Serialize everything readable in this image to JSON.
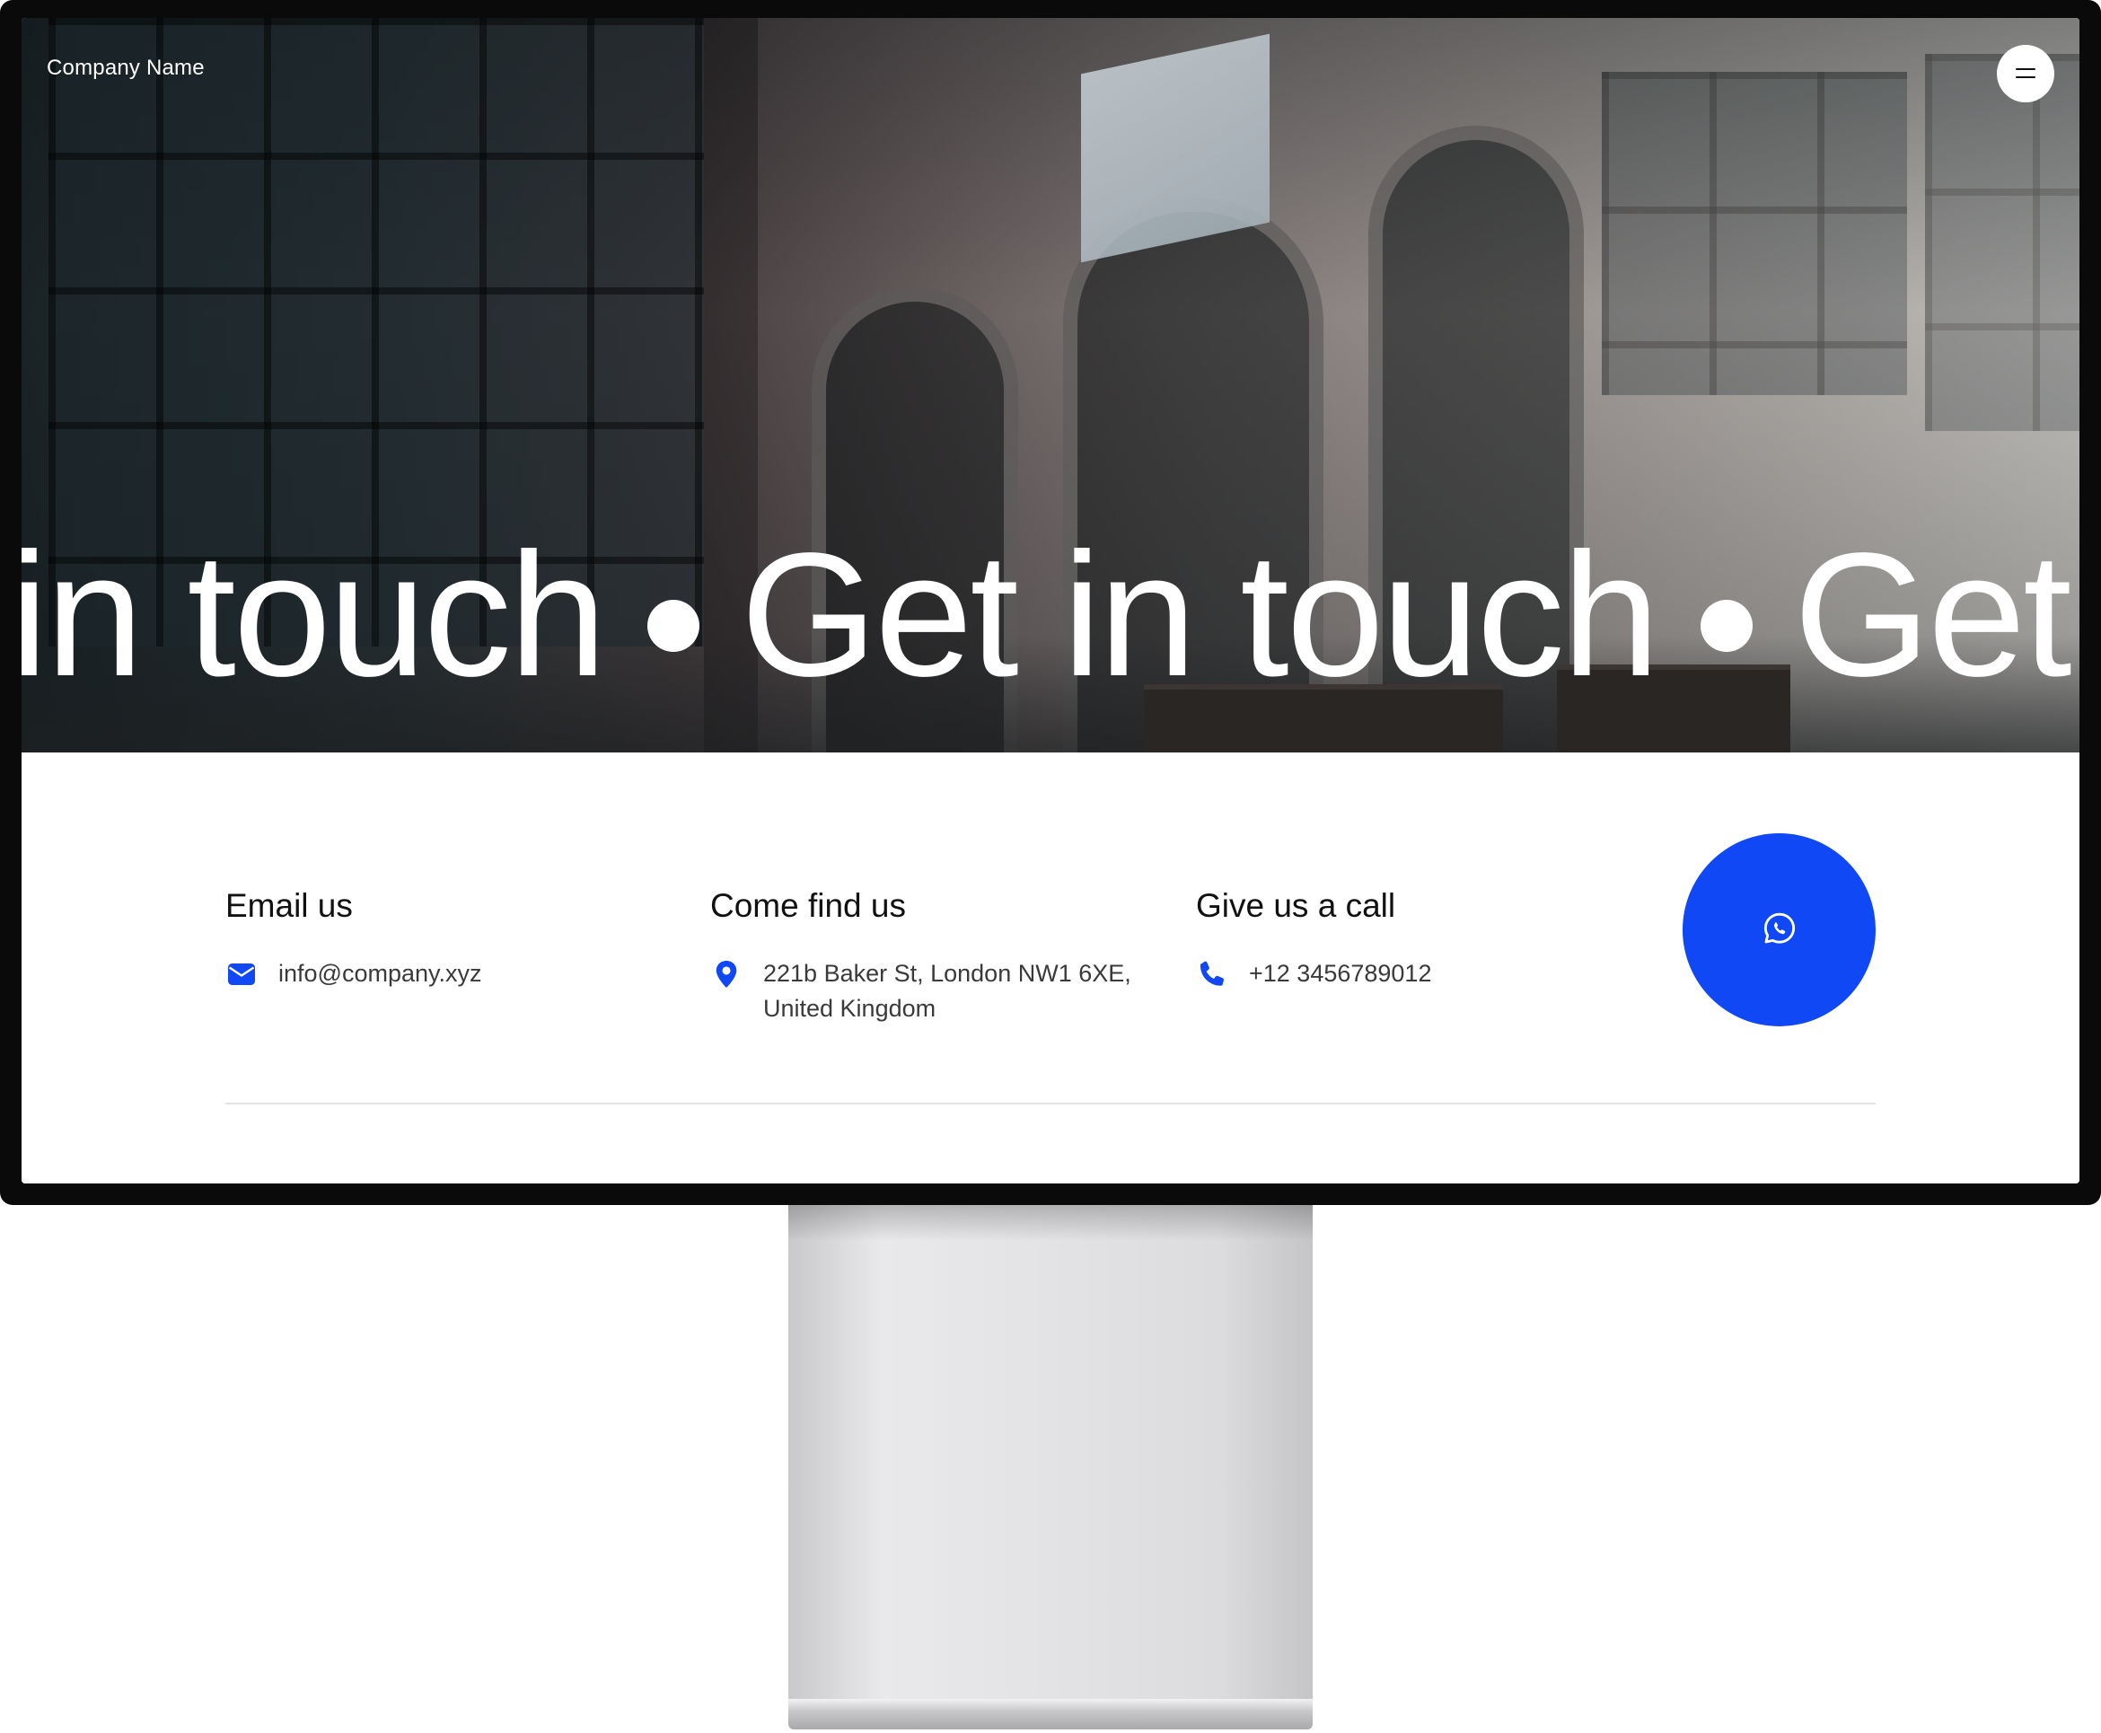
{
  "header": {
    "company_name": "Company Name",
    "menu_icon": "hamburger-menu-icon"
  },
  "hero": {
    "marquee": [
      "Get in touch",
      "Get in touch",
      "Get in touch"
    ],
    "separator_icon": "bullet-dot"
  },
  "contact": {
    "email": {
      "title": "Email us",
      "value": "info@company.xyz",
      "icon": "envelope-icon"
    },
    "location": {
      "title": "Come find us",
      "address_line1": "221b Baker St, London NW1 6XE,",
      "address_line2": "United Kingdom",
      "icon": "map-pin-icon"
    },
    "phone": {
      "title": "Give us a call",
      "value": "+12 3456789012",
      "icon": "phone-icon"
    },
    "whatsapp_button": {
      "icon": "whatsapp-icon"
    }
  },
  "colors": {
    "accent": "#1148f5",
    "text_primary": "#111111",
    "text_secondary": "#3a3a3a",
    "divider": "#e2e2e2"
  }
}
